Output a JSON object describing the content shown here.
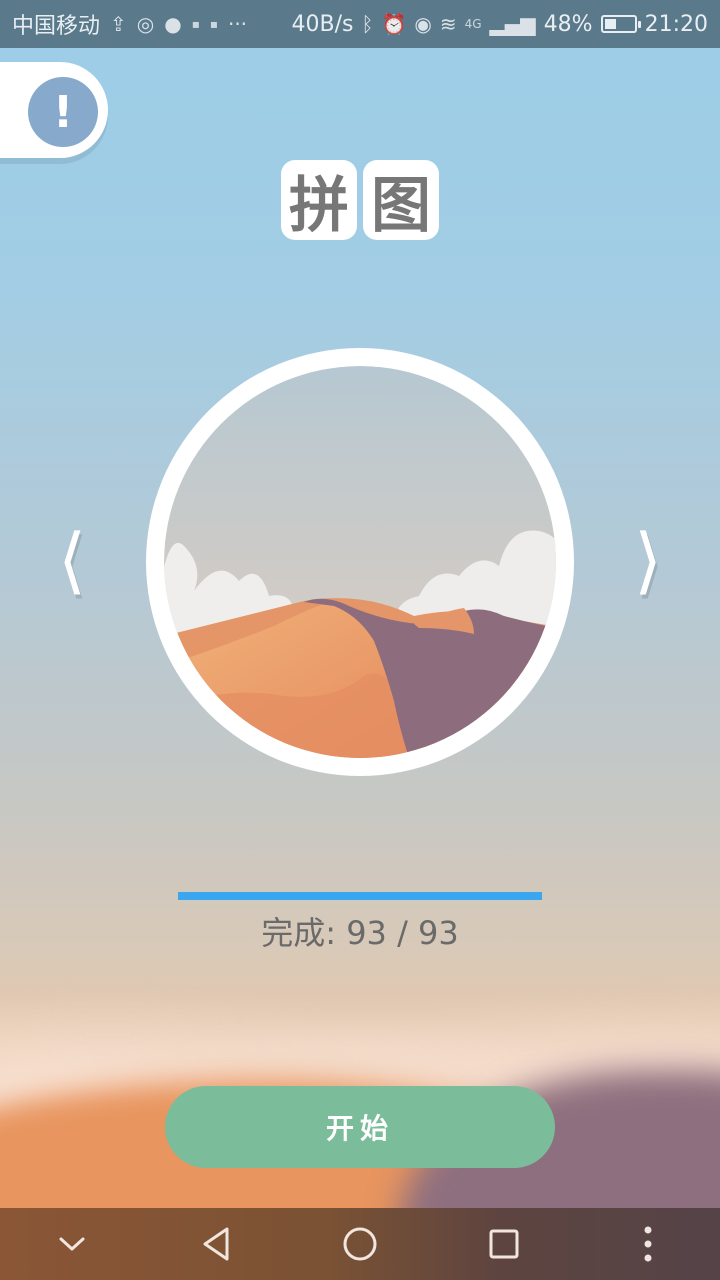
{
  "status_bar": {
    "carrier": "中国移动",
    "network_speed": "40B/s",
    "signal_type": "4G",
    "battery_percent": "48%",
    "battery_level": 0.48,
    "time": "21:20",
    "icons": [
      "upload-icon",
      "weibo-icon",
      "wechat-icon",
      "notification-icon",
      "notification-icon",
      "more-dots-icon",
      "bluetooth-icon",
      "alarm-icon",
      "eye-icon",
      "wifi-icon",
      "signal-icon",
      "battery-icon"
    ]
  },
  "header": {
    "info_symbol": "!",
    "title_chars": [
      "拼",
      "图"
    ]
  },
  "carousel": {
    "prev_label": "⟨",
    "next_label": "⟩",
    "current_image": "desert-dunes"
  },
  "progress": {
    "label": "完成: 93 / 93",
    "completed": 93,
    "total": 93,
    "fraction": 1.0
  },
  "actions": {
    "start_label": "开始"
  },
  "colors": {
    "accent": "#3aa6ef",
    "start_button": "#7bbd9a",
    "info_circle": "#87a9cc"
  },
  "nav_bar": {
    "icons": [
      "collapse-icon",
      "back-icon",
      "home-icon",
      "recents-icon",
      "menu-dots-icon"
    ]
  }
}
